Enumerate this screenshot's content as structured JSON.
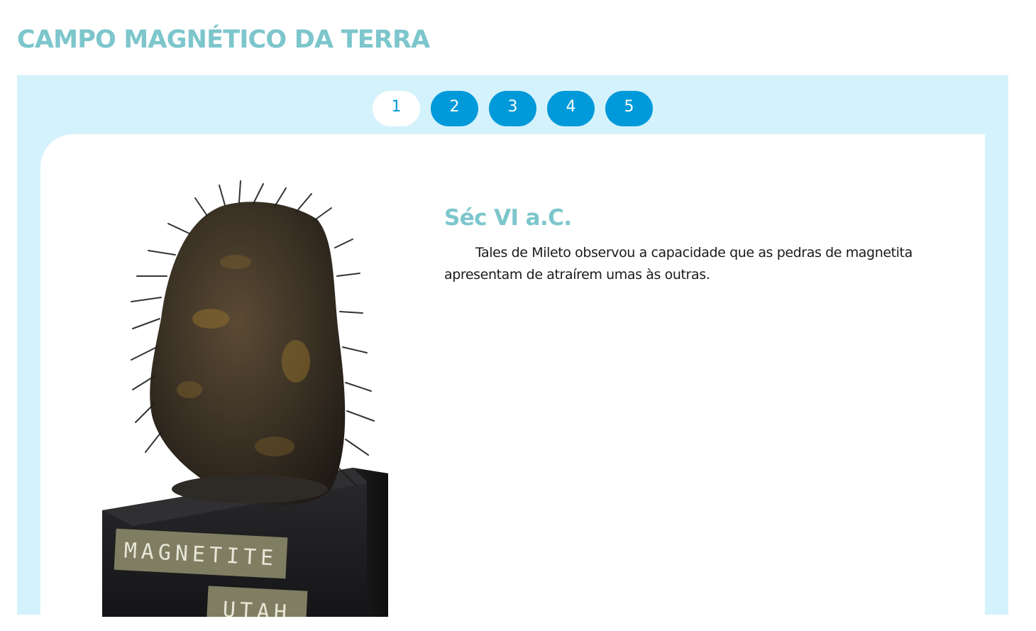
{
  "page": {
    "title": "CAMPO MAGNÉTICO DA TERRA"
  },
  "pagination": {
    "current": 1,
    "pages": [
      {
        "label": "1",
        "active": true
      },
      {
        "label": "2",
        "active": false
      },
      {
        "label": "3",
        "active": false
      },
      {
        "label": "4",
        "active": false
      },
      {
        "label": "5",
        "active": false
      }
    ]
  },
  "slide": {
    "heading": "Séc VI a.C.",
    "body": "Tales de Mileto observou a capacidade que as pedras de magnetita apresentam de atraírem umas às outras.",
    "image": {
      "label_top": "MAGNETITE",
      "label_bottom": "UTAH"
    }
  },
  "colors": {
    "title": "#7cc6cc",
    "panel_bg": "#d4f2fc",
    "button_bg": "#0099d9",
    "button_active_bg": "#ffffff",
    "text": "#1a1a1a"
  }
}
